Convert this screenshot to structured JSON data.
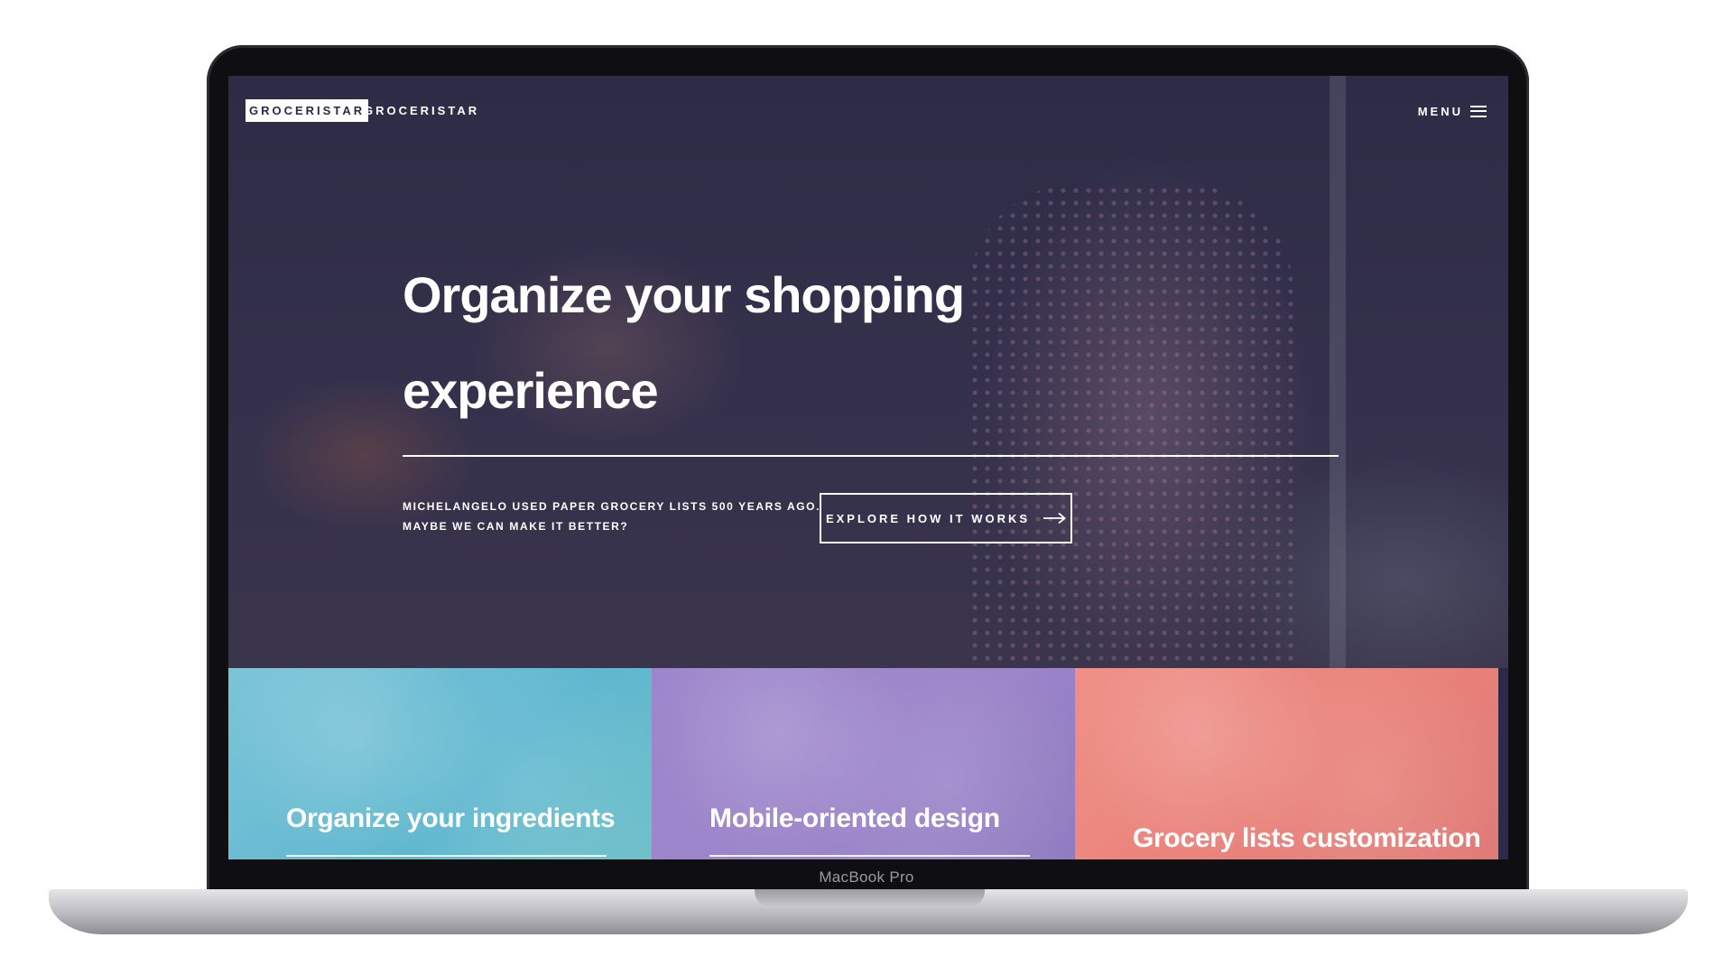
{
  "device": {
    "bezel_label": "MacBook Pro"
  },
  "nav": {
    "logo_box": "GROCERISTAR",
    "logo_text": "GROCERISTAR",
    "menu_label": "MENU",
    "menu_icon": "hamburger-icon"
  },
  "hero": {
    "headline_line1": "Organize your shopping",
    "headline_line2": "experience",
    "tagline_line1": "MICHELANGELO USED PAPER GROCERY LISTS 500 YEARS AGO.",
    "tagline_line2": "MAYBE WE CAN MAKE IT BETTER?",
    "cta_label": "EXPLORE HOW IT WORKS",
    "cta_icon": "arrow-right-icon"
  },
  "features": [
    {
      "label": "Organize your ingredients",
      "color": "#6cbfd6"
    },
    {
      "label": "Mobile-oriented design",
      "color": "#9a85ca"
    },
    {
      "label": "Grocery lists customization",
      "color": "#ec887f"
    }
  ],
  "colors": {
    "hero_overlay": "#2c2a48",
    "text": "#ffffff"
  }
}
